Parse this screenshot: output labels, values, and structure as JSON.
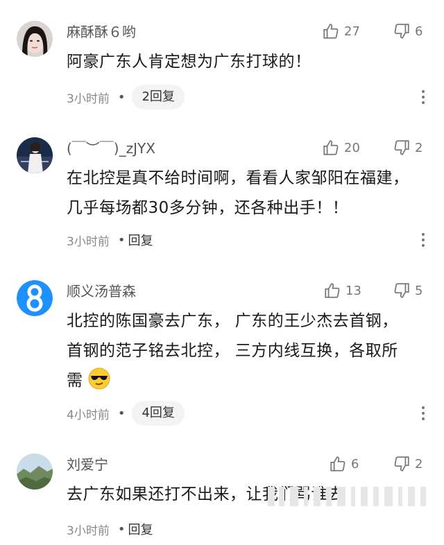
{
  "comments": [
    {
      "username": "麻酥酥６哟",
      "text": "阿豪广东人肯定想为广东打球的！",
      "time": "3小时前",
      "reply_label": "2回复",
      "likes": "27",
      "dislikes": "6"
    },
    {
      "username": "(￣︶￣)_zJYX",
      "text": "在北控是真不给时间啊，看看人家邹阳在福建，几乎每场都30多分钟，还各种出手！！",
      "time": "3小时前",
      "reply_label": "回复",
      "likes": "20",
      "dislikes": "2"
    },
    {
      "username": "顺义汤普森",
      "text": "北控的陈国豪去广东， 广东的王少杰去首钢， 首钢的范子铭去北控， 三方内线互换，各取所需",
      "time": "4小时前",
      "reply_label": "4回复",
      "likes": "13",
      "dislikes": "5"
    },
    {
      "username": "刘爱宁",
      "text": "去广东如果还打不出来，让我们骂谁去",
      "time": "3小时前",
      "reply_label": "回复",
      "likes": "6",
      "dislikes": "2"
    }
  ],
  "colors": {
    "avatar3": "#1e90ff",
    "text_primary": "#1a1a1a",
    "text_secondary": "#888888"
  },
  "icons": {
    "like": "thumbs-up-icon",
    "dislike": "thumbs-down-icon",
    "more": "more-vertical-icon",
    "emoji": "cool-sunglasses-emoji"
  }
}
